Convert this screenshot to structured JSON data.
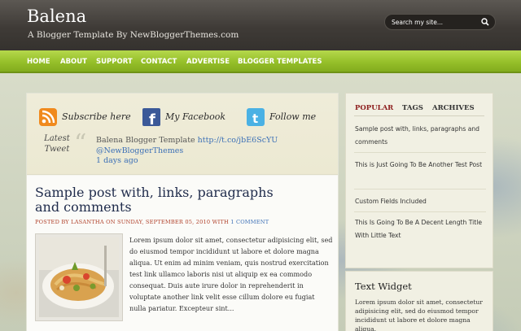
{
  "header": {
    "title": "Balena",
    "description": "A Blogger Template By NewBloggerThemes.com",
    "search_placeholder": "Search my site..."
  },
  "nav": {
    "items": [
      {
        "label": "HOME"
      },
      {
        "label": "ABOUT"
      },
      {
        "label": "SUPPORT"
      },
      {
        "label": "CONTACT"
      },
      {
        "label": "ADVERTISE"
      },
      {
        "label": "BLOGGER TEMPLATES"
      }
    ]
  },
  "social": {
    "subscribe_label": "Subscribe here",
    "facebook_label": "My Facebook",
    "twitter_label": "Follow me",
    "latest_tweet_line1": "Latest",
    "latest_tweet_line2": "Tweet",
    "tweet_text": "Balena Blogger Template ",
    "tweet_link": "http://t.co/jbE6ScYU",
    "tweet_user": "@NewBloggerThemes",
    "tweet_time": "1 days ago"
  },
  "post": {
    "title": "Sample post with, links, paragraphs and comments",
    "meta_posted_by": "POSTED BY LASANTHA ON SUNDAY, SEPTEMBER 05, 2010 WITH ",
    "meta_comments": "1 COMMENT",
    "body": "Lorem ipsum dolor sit amet, consectetur adipisicing elit, sed do eiusmod tempor incididunt ut labore et dolore magna aliqua. Ut enim ad minim veniam, quis nostrud exercitation test link ullamco laboris nisi ut aliquip ex ea commodo consequat. Duis aute irure dolor in reprehenderit in voluptate another link velit esse cillum dolore eu fugiat nulla pariatur. Excepteur sint..."
  },
  "sidebar": {
    "tabs": [
      {
        "label": "POPULAR"
      },
      {
        "label": "TAGS"
      },
      {
        "label": "ARCHIVES"
      }
    ],
    "popular": [
      {
        "label": "Sample post with, links, paragraphs and comments"
      },
      {
        "label": "This is Just Going To Be Another Test Post"
      },
      {
        "label": "Custom Fields Included"
      },
      {
        "label": "This Is Going To Be A Decent Length Title With Little Text"
      }
    ],
    "widget_title": "Text Widget",
    "widget_text": "Lorem ipsum dolor sit amet, consectetur adipisicing elit, sed do eiusmod tempor incididunt ut labore et dolore magna aliqua."
  },
  "colors": {
    "nav_green": "#96c02a",
    "header_dark": "#3f3b37",
    "link_blue": "#3b6fb6",
    "meta_red": "#b0402a",
    "tab_active": "#8c1d1d"
  },
  "icons": [
    "search-icon",
    "rss-icon",
    "facebook-icon",
    "twitter-icon",
    "quote-icon"
  ]
}
